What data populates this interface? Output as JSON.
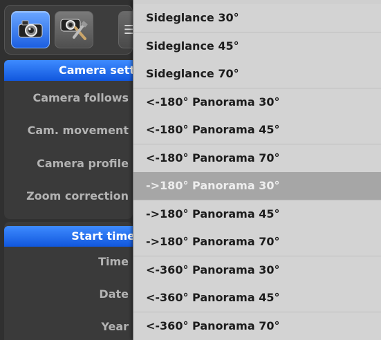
{
  "toolbar": {
    "buttons": [
      {
        "name": "camera-icon",
        "active": true
      },
      {
        "name": "camera-tools-icon",
        "active": false
      },
      {
        "name": "list-icon",
        "active": false
      }
    ]
  },
  "camera_settings": {
    "header": "Camera sett",
    "rows": [
      "Camera follows",
      "Cam. movement",
      "Camera profile",
      "Zoom correction"
    ]
  },
  "start_time": {
    "header": "Start time",
    "rows": [
      "Time",
      "Date",
      "Year"
    ]
  },
  "menu": {
    "highlighted_index": 6,
    "items": [
      "Sideglance 30°",
      "Sideglance 45°",
      "Sideglance 70°",
      "<-180° Panorama 30°",
      "<-180° Panorama 45°",
      "<-180° Panorama 70°",
      "->180° Panorama 30°",
      "->180° Panorama 45°",
      "->180° Panorama 70°",
      "<-360° Panorama 30°",
      "<-360° Panorama 45°",
      "<-360° Panorama 70°"
    ]
  }
}
